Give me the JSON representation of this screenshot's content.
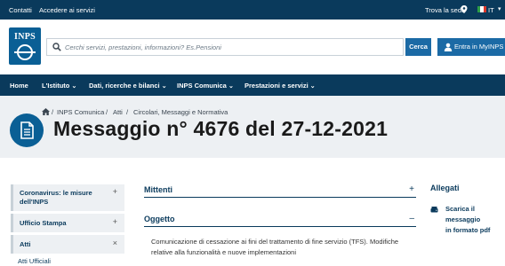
{
  "topbar": {
    "links": [
      "Contatti",
      "Accedere ai servizi"
    ],
    "trova_sede": "Trova la sede",
    "language": "IT"
  },
  "header": {
    "logo_text": "INPS",
    "search_placeholder": "Cerchi servizi, prestazioni, informazioni? Es.Pensioni",
    "search_button": "Cerca",
    "login_button": "Entra in MyINPS"
  },
  "nav": {
    "items": [
      "Home",
      "L'Istituto",
      "Dati, ricerche e bilanci",
      "INPS Comunica",
      "Prestazioni e servizi"
    ]
  },
  "breadcrumb": [
    "INPS Comunica",
    "Atti",
    "Circolari, Messaggi e Normativa"
  ],
  "page_title": "Messaggio n° 4676 del 27-12-2021",
  "sidebar": {
    "items": [
      {
        "label": "Coronavirus: le misure dell'INPS",
        "toggle": "+"
      },
      {
        "label": "Ufficio Stampa",
        "toggle": "+"
      },
      {
        "label": "Atti",
        "toggle": "×"
      }
    ],
    "subitem": "Atti Ufficiali"
  },
  "main": {
    "sections": [
      {
        "title": "Mittenti",
        "toggle": "+"
      },
      {
        "title": "Oggetto",
        "toggle": "–"
      }
    ],
    "oggetto_text": "Comunicazione di cessazione ai fini del trattamento di fine servizio (TFS). Modifiche relative alla funzionalità e nuove implementazioni"
  },
  "allegati": {
    "title": "Allegati",
    "download_line1": "Scarica il messaggio",
    "download_line2": "in formato pdf"
  },
  "colors": {
    "dark_blue": "#0a3a5c",
    "brand_blue": "#0a5f95",
    "button_blue": "#1b6aa5",
    "hero_gray": "#edf0f3"
  }
}
